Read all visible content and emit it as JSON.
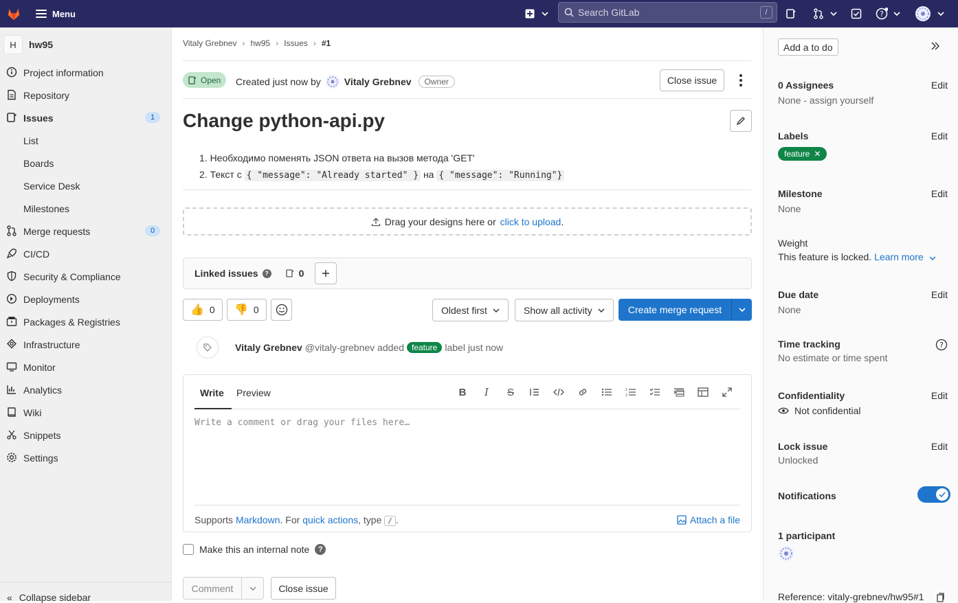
{
  "topbar": {
    "menu_label": "Menu",
    "search_placeholder": "Search GitLab",
    "search_shortcut": "/"
  },
  "sidebar": {
    "project_initial": "H",
    "project_name": "hw95",
    "items": [
      {
        "label": "Project information"
      },
      {
        "label": "Repository"
      },
      {
        "label": "Issues",
        "count": "1"
      },
      {
        "label": "List"
      },
      {
        "label": "Boards"
      },
      {
        "label": "Service Desk"
      },
      {
        "label": "Milestones"
      },
      {
        "label": "Merge requests",
        "count": "0"
      },
      {
        "label": "CI/CD"
      },
      {
        "label": "Security & Compliance"
      },
      {
        "label": "Deployments"
      },
      {
        "label": "Packages & Registries"
      },
      {
        "label": "Infrastructure"
      },
      {
        "label": "Monitor"
      },
      {
        "label": "Analytics"
      },
      {
        "label": "Wiki"
      },
      {
        "label": "Snippets"
      },
      {
        "label": "Settings"
      }
    ],
    "collapse_label": "Collapse sidebar"
  },
  "breadcrumb": [
    "Vitaly Grebnev",
    "hw95",
    "Issues",
    "#1"
  ],
  "issue": {
    "status": "Open",
    "created_prefix": "Created just now by",
    "author": "Vitaly Grebnev",
    "author_role": "Owner",
    "close_label": "Close issue",
    "title": "Change python-api.py",
    "desc_1": "1. Необходимо поменять JSON ответа на вызов метода 'GET'",
    "desc_2_a": "2. Текст с",
    "desc_2_code1": "{ \"message\": \"Already started\" }",
    "desc_2_b": "на",
    "desc_2_code2": "{ \"message\": \"Running\"}"
  },
  "designs": {
    "text": "Drag your designs here or",
    "link": "click to upload",
    "suffix": "."
  },
  "linked": {
    "label": "Linked issues",
    "count": "0"
  },
  "reactions": {
    "thumbs_up": "0",
    "thumbs_down": "0"
  },
  "sort": {
    "order": "Oldest first",
    "filter": "Show all activity",
    "create_mr": "Create merge request"
  },
  "activity": {
    "author": "Vitaly Grebnev",
    "handle": "@vitaly-grebnev added",
    "label": "feature",
    "suffix": "label just now"
  },
  "editor": {
    "tab_write": "Write",
    "tab_preview": "Preview",
    "placeholder": "Write a comment or drag your files here…",
    "supports": "Supports",
    "markdown": "Markdown",
    "for": ". For",
    "quick_actions": "quick actions",
    "type": ", type",
    "slash": "/",
    "dot": ".",
    "attach": "Attach a file"
  },
  "internal_note": "Make this an internal note",
  "footer": {
    "comment": "Comment",
    "close": "Close issue"
  },
  "right": {
    "todo": "Add a to do",
    "assignees_title": "0 Assignees",
    "assignees_val": "None - assign yourself",
    "labels_title": "Labels",
    "label_value": "feature",
    "milestone_title": "Milestone",
    "milestone_val": "None",
    "weight_title": "Weight",
    "weight_text": "This feature is locked.",
    "weight_link": "Learn more",
    "due_title": "Due date",
    "due_val": "None",
    "time_title": "Time tracking",
    "time_val": "No estimate or time spent",
    "conf_title": "Confidentiality",
    "conf_val": "Not confidential",
    "lock_title": "Lock issue",
    "lock_val": "Unlocked",
    "notif_title": "Notifications",
    "participants": "1 participant",
    "reference": "Reference: vitaly-grebnev/hw95#1",
    "edit": "Edit"
  },
  "colors": {
    "topbar": "#292961",
    "primary": "#1f75cb",
    "label_green": "#108548",
    "open_badge": "#c3e6cd"
  }
}
